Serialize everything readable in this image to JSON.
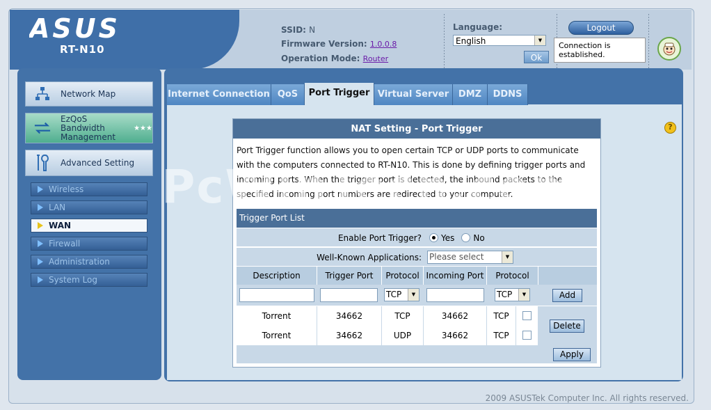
{
  "header": {
    "brand": "ASUS",
    "model": "RT-N10",
    "ssid_label": "SSID:",
    "ssid_value": "N",
    "firmware_label": "Firmware Version:",
    "firmware_value": "1.0.0.8",
    "mode_label": "Operation Mode:",
    "mode_value": "Router",
    "language_label": "Language:",
    "language_value": "English",
    "ok_label": "Ok",
    "logout_label": "Logout",
    "status_text": "Connection is established."
  },
  "sidebar": {
    "main_items": [
      {
        "label": "Network Map",
        "icon": "network-map-icon"
      },
      {
        "label": "EzQoS Bandwidth Management",
        "icon": "bandwidth-icon"
      },
      {
        "label": "Advanced Setting",
        "icon": "tools-icon"
      }
    ],
    "sub_items": [
      {
        "label": "Wireless",
        "active": false
      },
      {
        "label": "LAN",
        "active": false
      },
      {
        "label": "WAN",
        "active": true
      },
      {
        "label": "Firewall",
        "active": false
      },
      {
        "label": "Administration",
        "active": false
      },
      {
        "label": "System Log",
        "active": false
      }
    ]
  },
  "tabs": [
    {
      "label": "Internet Connection",
      "active": false
    },
    {
      "label": "QoS",
      "active": false
    },
    {
      "label": "Port Trigger",
      "active": true
    },
    {
      "label": "Virtual Server",
      "active": false
    },
    {
      "label": "DMZ",
      "active": false
    },
    {
      "label": "DDNS",
      "active": false
    }
  ],
  "panel": {
    "title": "NAT Setting - Port Trigger",
    "description": "Port Trigger function allows you to open certain TCP or UDP ports to communicate with the computers connected to RT-N10. This is done by defining trigger ports and incoming ports. When the trigger port is detected, the inbound packets to the specified incoming port numbers are redirected to your computer.",
    "watermark": "PcWinTech.com",
    "list_title": "Trigger Port List",
    "enable_label": "Enable Port Trigger?",
    "enable_yes": "Yes",
    "enable_no": "No",
    "enable_value": "Yes",
    "apps_label": "Well-Known Applications:",
    "apps_placeholder": "Please select",
    "columns": [
      "Description",
      "Trigger Port",
      "Protocol",
      "Incoming Port",
      "Protocol"
    ],
    "new_trigger_protocol": "TCP",
    "new_incoming_protocol": "TCP",
    "add_label": "Add",
    "delete_label": "Delete",
    "apply_label": "Apply",
    "rows": [
      {
        "description": "Torrent",
        "trigger_port": "34662",
        "protocol": "TCP",
        "incoming_port": "34662",
        "incoming_protocol": "TCP"
      },
      {
        "description": "Torrent",
        "trigger_port": "34662",
        "protocol": "UDP",
        "incoming_port": "34662",
        "incoming_protocol": "TCP"
      }
    ]
  },
  "footer": {
    "copyright": "2009 ASUSTek Computer Inc. All rights reserved."
  },
  "colors": {
    "brand_blue": "#4372a8",
    "panel_header": "#4a6f98",
    "content_bg": "#d6e4ef"
  }
}
